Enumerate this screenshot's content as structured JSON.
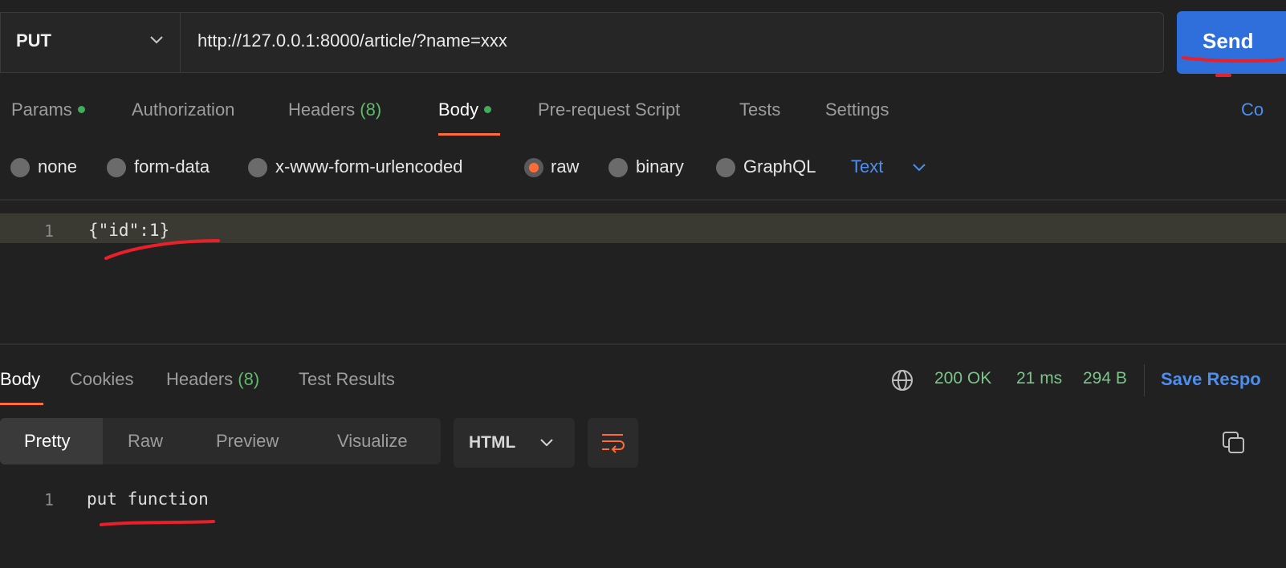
{
  "request": {
    "method": "PUT",
    "url": "http://127.0.0.1:8000/article/?name=xxx",
    "send_label": "Send"
  },
  "request_tabs": {
    "params": "Params",
    "authorization": "Authorization",
    "headers": "Headers",
    "headers_count": "(8)",
    "body": "Body",
    "prerequest": "Pre-request Script",
    "tests": "Tests",
    "settings": "Settings",
    "cookies_cut": "Co"
  },
  "body_types": {
    "none": "none",
    "form_data": "form-data",
    "urlencoded": "x-www-form-urlencoded",
    "raw": "raw",
    "binary": "binary",
    "graphql": "GraphQL",
    "format": "Text",
    "selected": "raw"
  },
  "editor": {
    "line_number": "1",
    "code": "{\"id\":1}"
  },
  "response": {
    "tabs": {
      "body": "Body",
      "cookies": "Cookies",
      "headers": "Headers",
      "headers_count": "(8)",
      "test_results": "Test Results"
    },
    "status": "200 OK",
    "time": "21 ms",
    "size": "294 B",
    "save_label": "Save Respo",
    "views": {
      "pretty": "Pretty",
      "raw": "Raw",
      "preview": "Preview",
      "visualize": "Visualize"
    },
    "language": "HTML",
    "line_number": "1",
    "content": "put function"
  },
  "colors": {
    "accent": "#ff6c37",
    "link": "#4d8ff0",
    "success": "#7cc48a",
    "send": "#2f6fdb",
    "annotation": "#e8202a"
  },
  "icons": [
    "chevron-down-icon",
    "globe-icon",
    "wrap-lines-icon",
    "copy-icon"
  ]
}
